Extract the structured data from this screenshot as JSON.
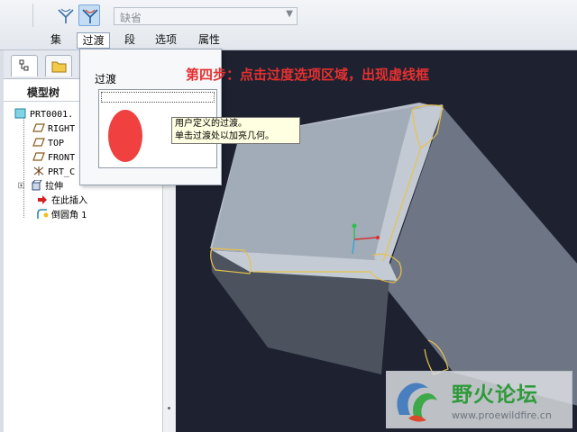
{
  "toolbar": {
    "set_select_value": "缺省",
    "icons": {
      "fillet_a": "fillet-tool-icon",
      "fillet_b": "transition-mode-icon",
      "dropdown": "chevron-down-icon"
    }
  },
  "tabs": [
    {
      "label": "集"
    },
    {
      "label": "过渡",
      "active": true
    },
    {
      "label": "段"
    },
    {
      "label": "选项"
    },
    {
      "label": "属性"
    }
  ],
  "left_panel": {
    "title": "模型树",
    "tabs_icons": [
      "model-tree-icon",
      "folder-icon"
    ],
    "items": [
      {
        "label": "PRT0001.",
        "icon": "part-icon"
      },
      {
        "label": "RIGHT",
        "icon": "datum-plane-icon"
      },
      {
        "label": "TOP",
        "icon": "datum-plane-icon"
      },
      {
        "label": "FRONT",
        "icon": "datum-plane-icon"
      },
      {
        "label": "PRT_C",
        "icon": "coordinate-system-icon"
      },
      {
        "label": "拉伸",
        "icon": "extrude-icon"
      },
      {
        "label": "在此插入",
        "icon": "insert-here-arrow-icon"
      },
      {
        "label": "倒圆角 1",
        "icon": "round-icon"
      }
    ]
  },
  "transitions_panel": {
    "label": "过渡"
  },
  "tooltip": {
    "line1": "用户定义的过渡。",
    "line2": "单击过渡处以加亮几何。"
  },
  "annotation": {
    "text": "第四步：点击过度选项区域，出现虚线框"
  },
  "watermark": {
    "title": "野火论坛",
    "url": "www.proewildfire.cn"
  },
  "colors": {
    "annotation": "#e53030",
    "viewport_bg": "#1e2230",
    "cube_face": "#a9b2be",
    "fillet_edge": "#e8c24a",
    "watermark_green": "#2f9a3a"
  }
}
